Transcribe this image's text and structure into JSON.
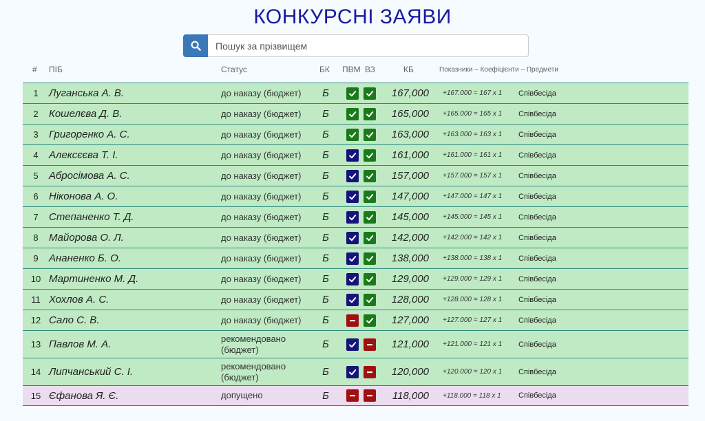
{
  "title": "КОНКУРСНІ ЗАЯВИ",
  "search": {
    "placeholder": "Пошук за прізвищем"
  },
  "columns": {
    "num": "#",
    "name": "ПІБ",
    "status": "Статус",
    "bk": "БК",
    "pvm": "ПВМ",
    "vz": "ВЗ",
    "kb": "КБ",
    "details": "Показники – Коефіцієнти – Предмети"
  },
  "colors": {
    "approved_row": "#bfeac4",
    "admitted_row": "#ecdcef",
    "check_green": "#1a7a1a",
    "check_blue": "#14147a",
    "minus_red": "#a01010"
  },
  "rows": [
    {
      "num": "1",
      "name": "Луганська А. В.",
      "status": "до наказу (бюджет)",
      "bk": "Б",
      "pvm": "check-green",
      "vz": "check-green",
      "kb": "167,000",
      "formula": "+167.000 = 167 x 1",
      "subject": "Співбесіда",
      "type": "normal"
    },
    {
      "num": "2",
      "name": "Кошелєва Д. В.",
      "status": "до наказу (бюджет)",
      "bk": "Б",
      "pvm": "check-green",
      "vz": "check-green",
      "kb": "165,000",
      "formula": "+165.000 = 165 x 1",
      "subject": "Співбесіда",
      "type": "normal"
    },
    {
      "num": "3",
      "name": "Григоренко А. С.",
      "status": "до наказу (бюджет)",
      "bk": "Б",
      "pvm": "check-green",
      "vz": "check-green",
      "kb": "163,000",
      "formula": "+163.000 = 163 x 1",
      "subject": "Співбесіда",
      "type": "normal"
    },
    {
      "num": "4",
      "name": "Алексєєва Т. І.",
      "status": "до наказу (бюджет)",
      "bk": "Б",
      "pvm": "check-blue",
      "vz": "check-green",
      "kb": "161,000",
      "formula": "+161.000 = 161 x 1",
      "subject": "Співбесіда",
      "type": "normal"
    },
    {
      "num": "5",
      "name": "Абросімова А. С.",
      "status": "до наказу (бюджет)",
      "bk": "Б",
      "pvm": "check-blue",
      "vz": "check-green",
      "kb": "157,000",
      "formula": "+157.000 = 157 x 1",
      "subject": "Співбесіда",
      "type": "normal"
    },
    {
      "num": "6",
      "name": "Ніконова А. О.",
      "status": "до наказу (бюджет)",
      "bk": "Б",
      "pvm": "check-blue",
      "vz": "check-green",
      "kb": "147,000",
      "formula": "+147.000 = 147 x 1",
      "subject": "Співбесіда",
      "type": "normal"
    },
    {
      "num": "7",
      "name": "Степаненко Т. Д.",
      "status": "до наказу (бюджет)",
      "bk": "Б",
      "pvm": "check-blue",
      "vz": "check-green",
      "kb": "145,000",
      "formula": "+145.000 = 145 x 1",
      "subject": "Співбесіда",
      "type": "normal"
    },
    {
      "num": "8",
      "name": "Майорова О. Л.",
      "status": "до наказу (бюджет)",
      "bk": "Б",
      "pvm": "check-blue",
      "vz": "check-green",
      "kb": "142,000",
      "formula": "+142.000 = 142 x 1",
      "subject": "Співбесіда",
      "type": "normal"
    },
    {
      "num": "9",
      "name": "Ананенко Б. О.",
      "status": "до наказу (бюджет)",
      "bk": "Б",
      "pvm": "check-blue",
      "vz": "check-green",
      "kb": "138,000",
      "formula": "+138.000 = 138 x 1",
      "subject": "Співбесіда",
      "type": "normal"
    },
    {
      "num": "10",
      "name": "Мартиненко М. Д.",
      "status": "до наказу (бюджет)",
      "bk": "Б",
      "pvm": "check-blue",
      "vz": "check-green",
      "kb": "129,000",
      "formula": "+129.000 = 129 x 1",
      "subject": "Співбесіда",
      "type": "normal"
    },
    {
      "num": "11",
      "name": "Хохлов А. С.",
      "status": "до наказу (бюджет)",
      "bk": "Б",
      "pvm": "check-blue",
      "vz": "check-green",
      "kb": "128,000",
      "formula": "+128.000 = 128 x 1",
      "subject": "Співбесіда",
      "type": "normal"
    },
    {
      "num": "12",
      "name": "Сало С. В.",
      "status": "до наказу (бюджет)",
      "bk": "Б",
      "pvm": "minus-red",
      "vz": "check-green",
      "kb": "127,000",
      "formula": "+127.000 = 127 x 1",
      "subject": "Співбесіда",
      "type": "normal"
    },
    {
      "num": "13",
      "name": "Павлов М. А.",
      "status": "рекомендовано (бюджет)",
      "bk": "Б",
      "pvm": "check-blue",
      "vz": "minus-red",
      "kb": "121,000",
      "formula": "+121.000 = 121 x 1",
      "subject": "Співбесіда",
      "type": "tall"
    },
    {
      "num": "14",
      "name": "Липчанський С. І.",
      "status": "рекомендовано (бюджет)",
      "bk": "Б",
      "pvm": "check-blue",
      "vz": "minus-red",
      "kb": "120,000",
      "formula": "+120.000 = 120 x 1",
      "subject": "Співбесіда",
      "type": "tall"
    },
    {
      "num": "15",
      "name": "Єфанова Я. Є.",
      "status": "допущено",
      "bk": "Б",
      "pvm": "minus-red",
      "vz": "minus-red",
      "kb": "118,000",
      "formula": "+118.000 = 118 x 1",
      "subject": "Співбесіда",
      "type": "admitted"
    }
  ]
}
